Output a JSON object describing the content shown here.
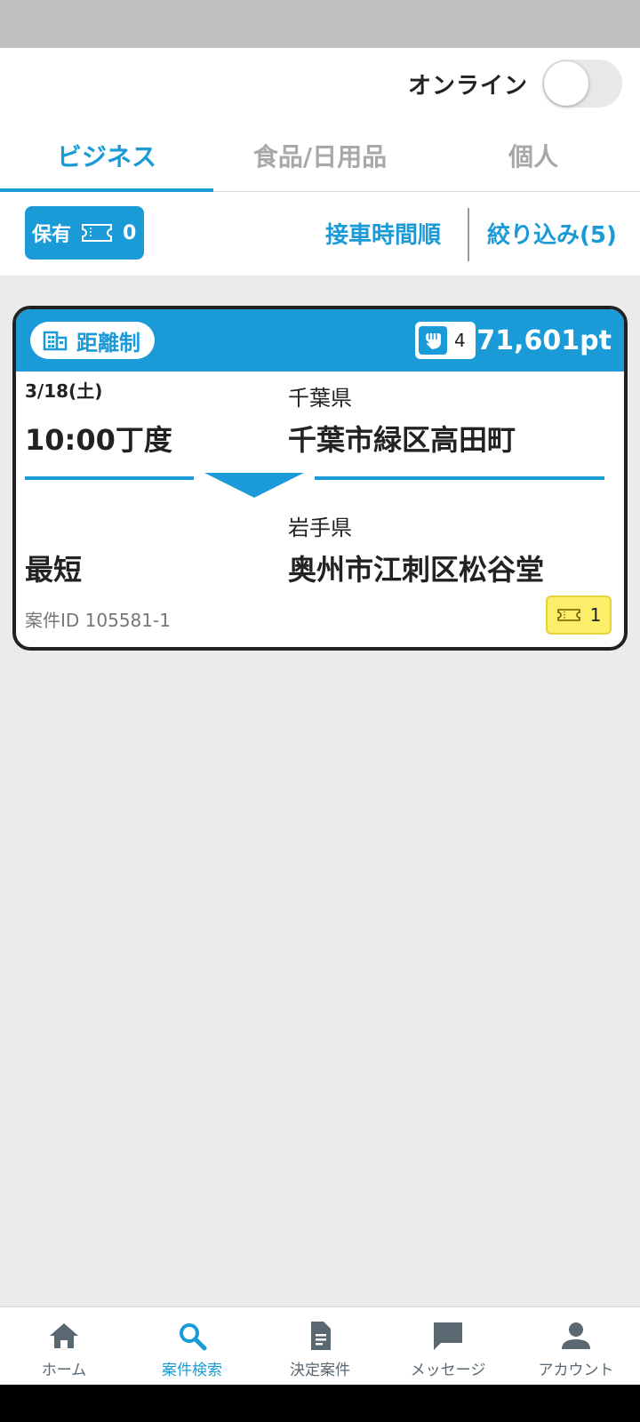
{
  "header": {
    "online_label": "オンライン",
    "online_enabled": false
  },
  "tabs": [
    {
      "label": "ビジネス",
      "active": true
    },
    {
      "label": "食品/日用品",
      "active": false
    },
    {
      "label": "個人",
      "active": false
    }
  ],
  "filters": {
    "owned_label": "保有",
    "owned_count": "0",
    "sort_label": "接車時間順",
    "filter_label": "絞り込み(5)"
  },
  "job_card": {
    "type_label": "距離制",
    "badge_count": "4",
    "points": "71,601pt",
    "date": "3/18(土)",
    "time": "10:00丁度",
    "from_prefecture": "千葉県",
    "from_address": "千葉市緑区高田町",
    "to_prefecture": "岩手県",
    "arrival": "最短",
    "to_address": "奥州市江刺区松谷堂",
    "case_id": "案件ID 105581-1",
    "ticket_required": "1"
  },
  "bottom_nav": [
    {
      "label": "ホーム",
      "icon": "home-icon",
      "active": false
    },
    {
      "label": "案件検索",
      "icon": "search-icon",
      "active": true
    },
    {
      "label": "決定案件",
      "icon": "document-icon",
      "active": false
    },
    {
      "label": "メッセージ",
      "icon": "message-icon",
      "active": false
    },
    {
      "label": "アカウント",
      "icon": "account-icon",
      "active": false
    }
  ],
  "colors": {
    "accent": "#1a9bd7",
    "ticket_highlight": "#fbee6a",
    "background": "#ebebeb"
  }
}
